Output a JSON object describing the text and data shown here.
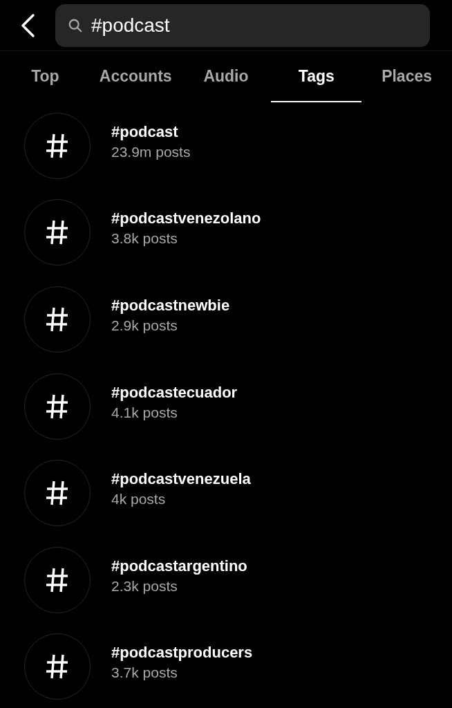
{
  "search": {
    "value": "#podcast"
  },
  "tabs": [
    {
      "label": "Top",
      "selected": false
    },
    {
      "label": "Accounts",
      "selected": false
    },
    {
      "label": "Audio",
      "selected": false
    },
    {
      "label": "Tags",
      "selected": true
    },
    {
      "label": "Places",
      "selected": false
    }
  ],
  "results": [
    {
      "name": "#podcast",
      "posts": "23.9m posts"
    },
    {
      "name": "#podcastvenezolano",
      "posts": "3.8k posts"
    },
    {
      "name": "#podcastnewbie",
      "posts": "2.9k posts"
    },
    {
      "name": "#podcastecuador",
      "posts": "4.1k posts"
    },
    {
      "name": "#podcastvenezuela",
      "posts": "4k posts"
    },
    {
      "name": "#podcastargentino",
      "posts": "2.3k posts"
    },
    {
      "name": "#podcastproducers",
      "posts": "3.7k posts"
    }
  ]
}
